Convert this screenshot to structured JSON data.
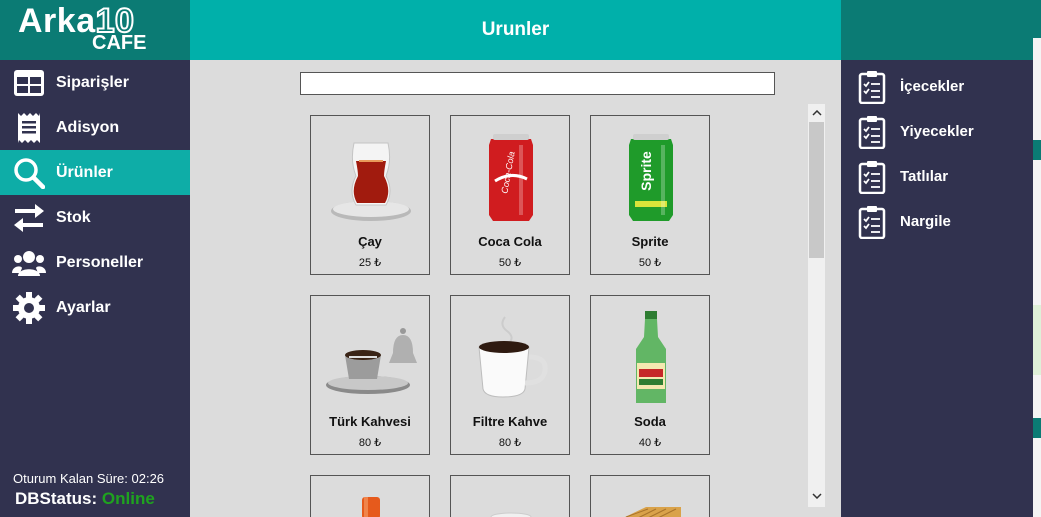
{
  "logo": {
    "line1_text": "Arka",
    "line1_number": "10",
    "line2": "CAFE"
  },
  "sidebar": {
    "items": [
      {
        "label": "Siparişler",
        "icon": "table-grid-icon"
      },
      {
        "label": "Adisyon",
        "icon": "receipt-icon"
      },
      {
        "label": "Ürünler",
        "icon": "search-icon",
        "active": true
      },
      {
        "label": "Stok",
        "icon": "swap-arrows-icon"
      },
      {
        "label": "Personeller",
        "icon": "users-icon"
      },
      {
        "label": "Ayarlar",
        "icon": "gear-icon"
      }
    ],
    "session_text": "Oturum Kalan Süre: 02:26",
    "db_label": "DBStatus:",
    "db_value": "Online"
  },
  "main": {
    "title": "Urunler",
    "search": {
      "value": "",
      "placeholder": ""
    },
    "products": [
      {
        "name": "Çay",
        "price": "25 ₺",
        "icon": "turkish-tea-glass-icon"
      },
      {
        "name": "Coca Cola",
        "price": "50 ₺",
        "icon": "cola-can-icon"
      },
      {
        "name": "Sprite",
        "price": "50 ₺",
        "icon": "sprite-can-icon"
      },
      {
        "name": "Türk Kahvesi",
        "price": "80 ₺",
        "icon": "turkish-coffee-cup-icon"
      },
      {
        "name": "Filtre Kahve",
        "price": "80 ₺",
        "icon": "coffee-mug-icon"
      },
      {
        "name": "Soda",
        "price": "40 ₺",
        "icon": "soda-bottle-icon"
      },
      {
        "name": "",
        "price": "",
        "icon": "orange-drink-icon"
      },
      {
        "name": "",
        "price": "",
        "icon": "cup-icon"
      },
      {
        "name": "",
        "price": "",
        "icon": "baklava-icon"
      }
    ]
  },
  "categories": {
    "items": [
      {
        "label": "İçecekler",
        "icon": "clipboard-checklist-icon"
      },
      {
        "label": "Yiyecekler",
        "icon": "clipboard-checklist-icon"
      },
      {
        "label": "Tatlılar",
        "icon": "clipboard-checklist-icon"
      },
      {
        "label": "Nargile",
        "icon": "clipboard-checklist-icon"
      }
    ]
  },
  "colors": {
    "sidebar_bg": "#31324f",
    "accent": "#00b0aa",
    "logo_bg": "#0b7b74",
    "online": "#1fa21f"
  }
}
